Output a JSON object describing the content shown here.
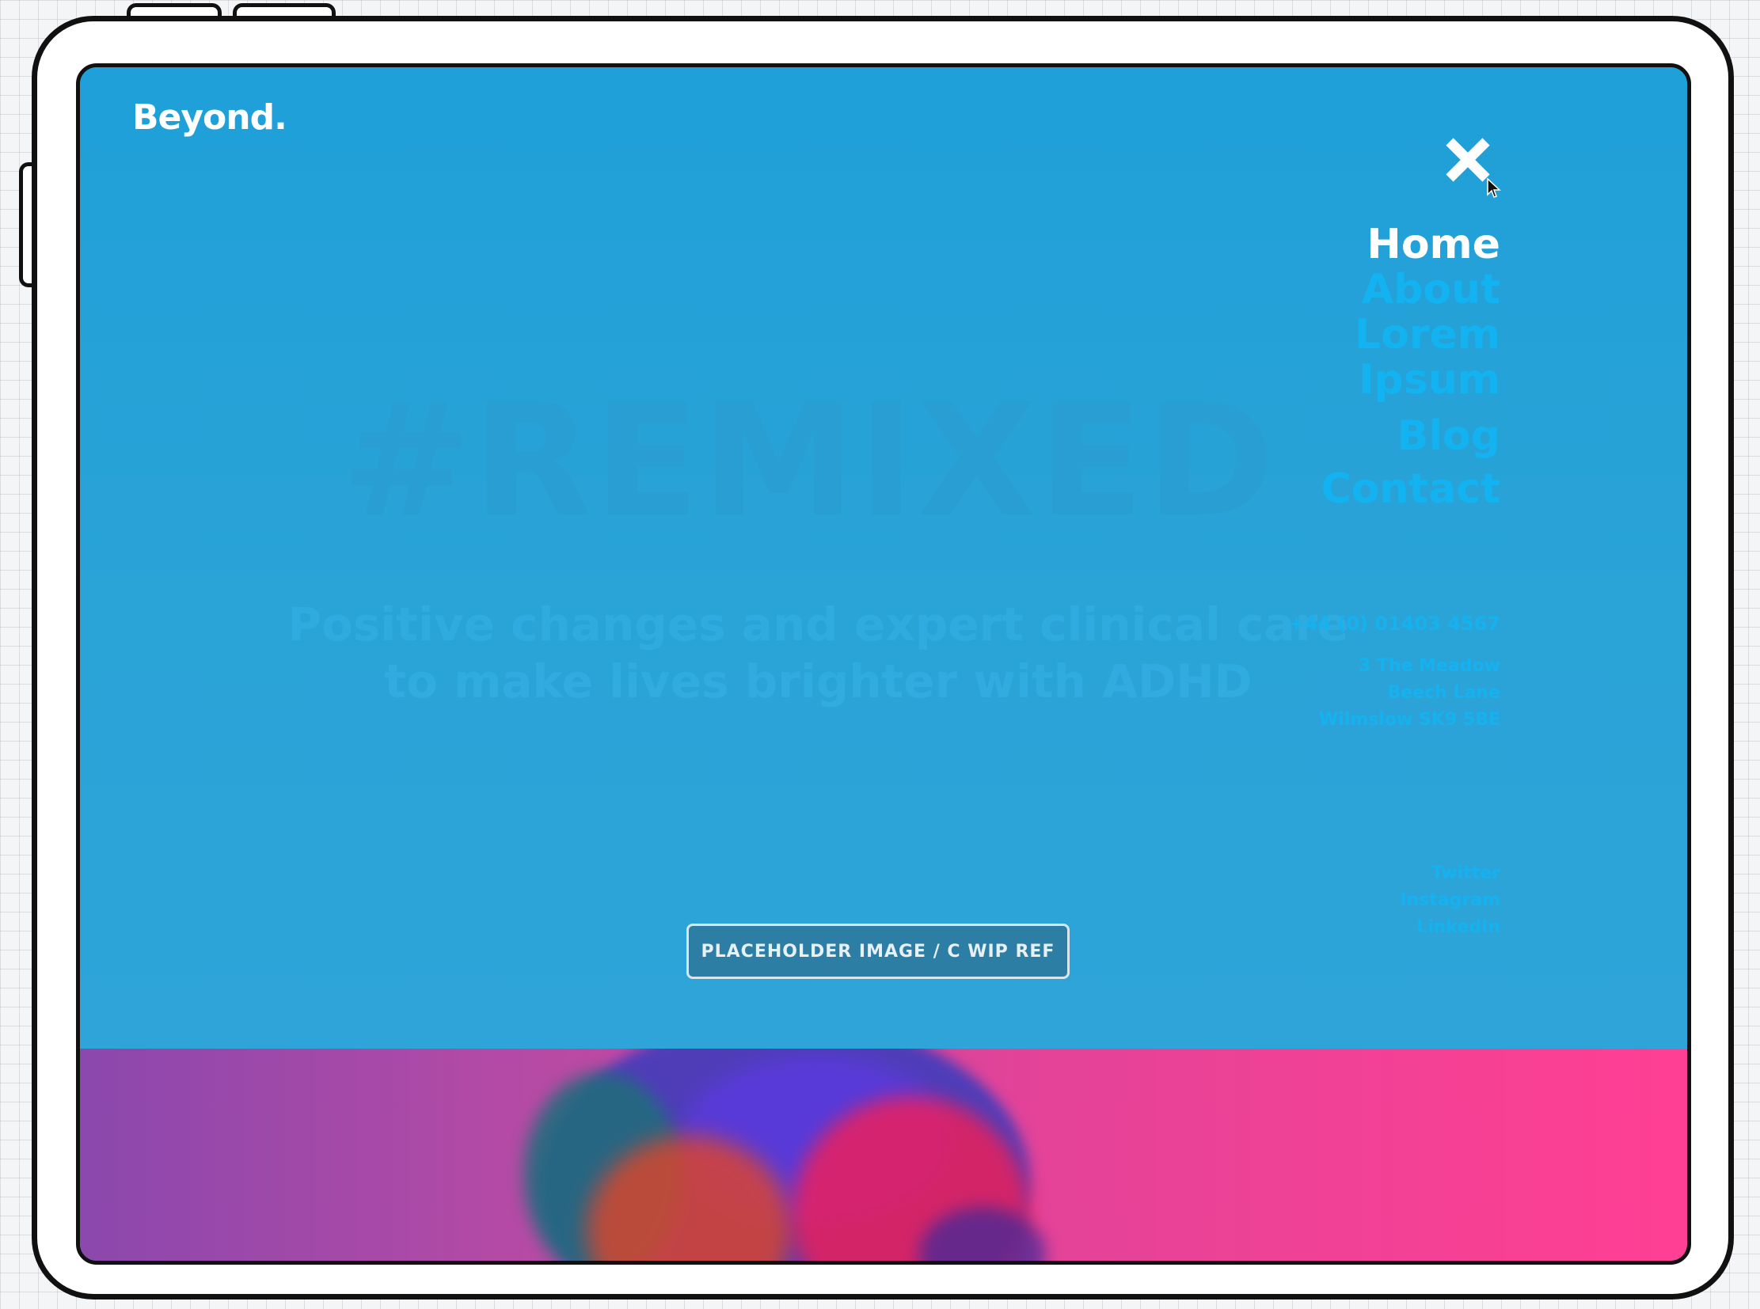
{
  "brand": {
    "logo_text": "Beyond."
  },
  "icons": {
    "close": "close-icon",
    "cursor": "cursor-icon"
  },
  "menu": {
    "items": [
      {
        "label": "Home",
        "active": true
      },
      {
        "label": "About",
        "active": false
      },
      {
        "label": "Lorem",
        "active": false
      },
      {
        "label": "Ipsum",
        "active": false
      },
      {
        "label": "Blog",
        "active": false
      },
      {
        "label": "Contact",
        "active": false
      }
    ],
    "phone": "+44 (0) 01403 4567",
    "address_lines": [
      "3 The Meadow",
      "Beech Lane",
      "Wilmslow SK9 5BE"
    ],
    "social": [
      "Twitter",
      "Instagram",
      "LinkedIn"
    ]
  },
  "hero": {
    "heading": "#REMIXED",
    "tagline_line1": "Positive changes and expert clinical care",
    "tagline_line2": "to make lives brighter with ADHD",
    "placeholder_label": "PLACEHOLDER IMAGE / C WIP REF"
  },
  "colors": {
    "overlay_blue": "#1fa0d8",
    "nav_inactive": "#13b3f1",
    "nav_active": "#ffffff",
    "hero_pink": "#ff3f93",
    "hero_purple": "#8b48ad"
  }
}
